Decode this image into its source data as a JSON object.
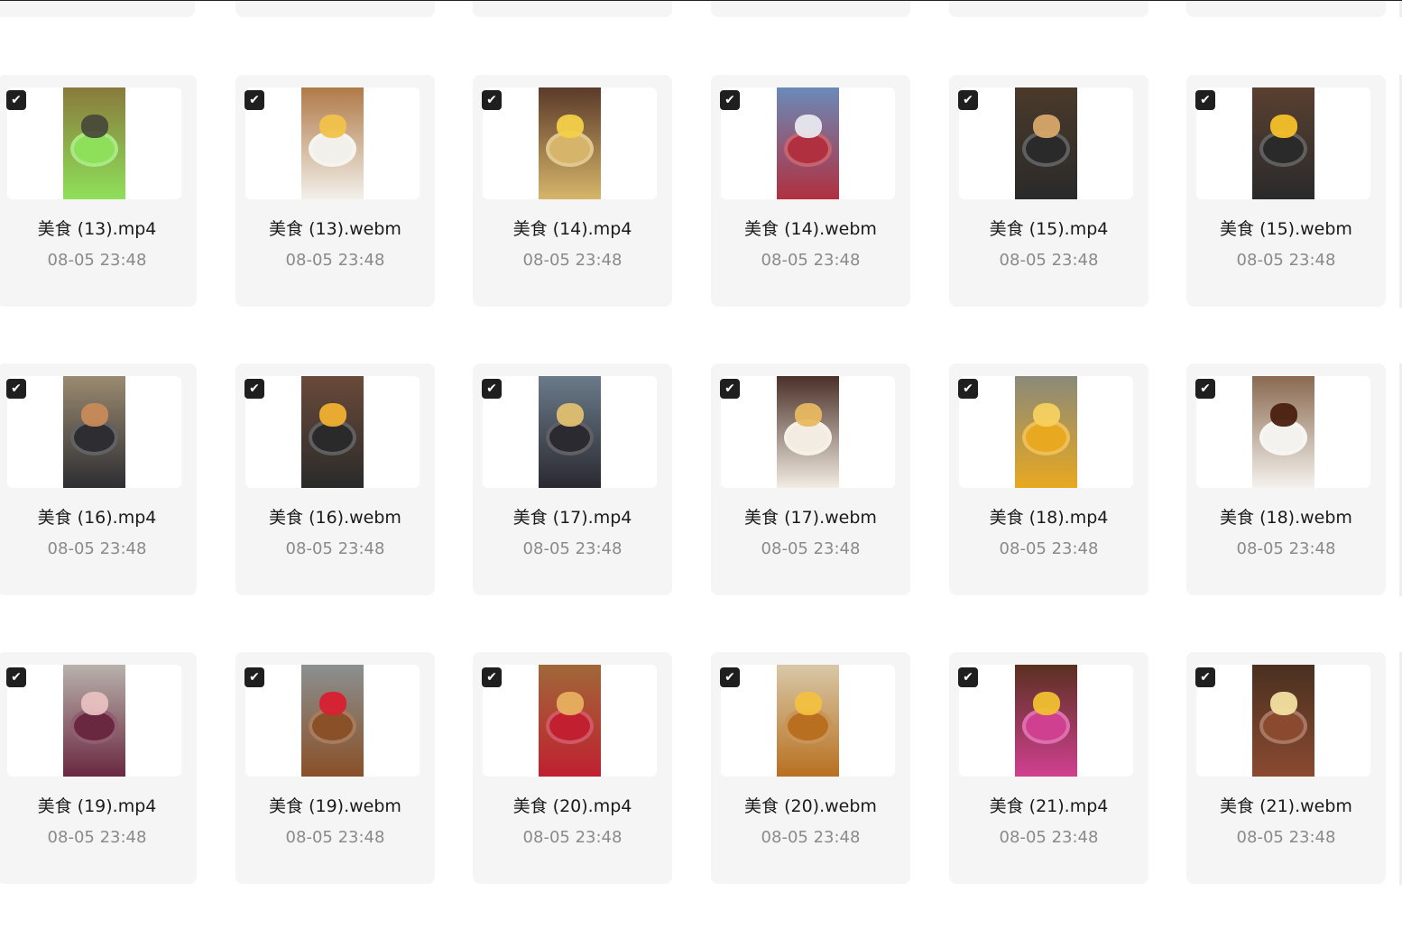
{
  "grid": {
    "files": [
      {
        "name": "美食 (13).mp4",
        "date": "08-05 23:48",
        "colors": [
          "#8a7a3c",
          "#8ee05a",
          "#4a4a3a"
        ]
      },
      {
        "name": "美食 (13).webm",
        "date": "08-05 23:48",
        "colors": [
          "#b07a48",
          "#f2f0ea",
          "#f1c24a"
        ]
      },
      {
        "name": "美食 (14).mp4",
        "date": "08-05 23:48",
        "colors": [
          "#5a3a2a",
          "#d6b56a",
          "#f3d049"
        ]
      },
      {
        "name": "美食 (14).webm",
        "date": "08-05 23:48",
        "colors": [
          "#6a8ab8",
          "#b03040",
          "#e8e8ee"
        ]
      },
      {
        "name": "美食 (15).mp4",
        "date": "08-05 23:48",
        "colors": [
          "#4a3a2a",
          "#2a2a2a",
          "#d8a86a"
        ]
      },
      {
        "name": "美食 (15).webm",
        "date": "08-05 23:48",
        "colors": [
          "#5a4030",
          "#2a2a2a",
          "#f6c02a"
        ]
      },
      {
        "name": "美食 (16).mp4",
        "date": "08-05 23:48",
        "colors": [
          "#9a8a70",
          "#2e2e32",
          "#c88a5a"
        ]
      },
      {
        "name": "美食 (16).webm",
        "date": "08-05 23:48",
        "colors": [
          "#6a4a3a",
          "#2a2a2a",
          "#f0b030"
        ]
      },
      {
        "name": "美食 (17).mp4",
        "date": "08-05 23:48",
        "colors": [
          "#6a7a8a",
          "#2a2a30",
          "#e0c070"
        ]
      },
      {
        "name": "美食 (17).webm",
        "date": "08-05 23:48",
        "colors": [
          "#4a3028",
          "#f2ece2",
          "#e8b860"
        ]
      },
      {
        "name": "美食 (18).mp4",
        "date": "08-05 23:48",
        "colors": [
          "#8a8a7a",
          "#e8a820",
          "#f6d060"
        ]
      },
      {
        "name": "美食 (18).webm",
        "date": "08-05 23:48",
        "colors": [
          "#8a6a50",
          "#f4f2ee",
          "#4a2010"
        ]
      },
      {
        "name": "美食 (19).mp4",
        "date": "08-05 23:48",
        "colors": [
          "#b8b2ac",
          "#6a2840",
          "#e8c0c0"
        ]
      },
      {
        "name": "美食 (19).webm",
        "date": "08-05 23:48",
        "colors": [
          "#8a9090",
          "#8a5028",
          "#d82030"
        ]
      },
      {
        "name": "美食 (20).mp4",
        "date": "08-05 23:48",
        "colors": [
          "#a06838",
          "#c02030",
          "#e8b060"
        ]
      },
      {
        "name": "美食 (20).webm",
        "date": "08-05 23:48",
        "colors": [
          "#d8c8a8",
          "#b87020",
          "#f2c040"
        ]
      },
      {
        "name": "美食 (21).mp4",
        "date": "08-05 23:48",
        "colors": [
          "#5a3020",
          "#d04090",
          "#f0c030"
        ]
      },
      {
        "name": "美食 (21).webm",
        "date": "08-05 23:48",
        "colors": [
          "#4a3020",
          "#8a4a30",
          "#f2e0a0"
        ]
      }
    ],
    "check_glyph": "✔"
  }
}
